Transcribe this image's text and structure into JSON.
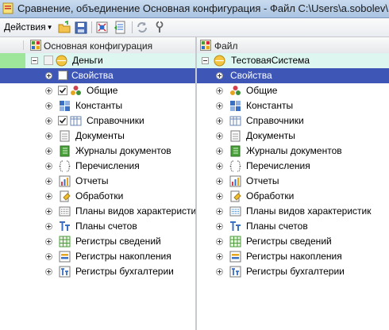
{
  "window": {
    "title": "Сравнение, объединение Основная конфигурация - Файл C:\\Users\\a.sobolev\\"
  },
  "toolbar": {
    "actions_label": "Действия"
  },
  "left": {
    "header": "Основная конфигурация",
    "root": "Деньги",
    "items": [
      "Свойства",
      "Общие",
      "Константы",
      "Справочники",
      "Документы",
      "Журналы документов",
      "Перечисления",
      "Отчеты",
      "Обработки",
      "Планы видов характеристик",
      "Планы счетов",
      "Регистры сведений",
      "Регистры накопления",
      "Регистры бухгалтерии"
    ]
  },
  "right": {
    "header": "Файл",
    "root": "ТестоваяСистема",
    "items": [
      "Свойства",
      "Общие",
      "Константы",
      "Справочники",
      "Документы",
      "Журналы документов",
      "Перечисления",
      "Отчеты",
      "Обработки",
      "Планы видов характеристик",
      "Планы счетов",
      "Регистры сведений",
      "Регистры накопления",
      "Регистры бухгалтерии"
    ]
  },
  "icons": [
    "properties-icon",
    "common-icon",
    "constants-icon",
    "catalogs-icon",
    "documents-icon",
    "journals-icon",
    "enums-icon",
    "reports-icon",
    "processing-icon",
    "char-types-icon",
    "chart-accounts-icon",
    "info-registers-icon",
    "accum-registers-icon",
    "accounting-registers-icon"
  ]
}
